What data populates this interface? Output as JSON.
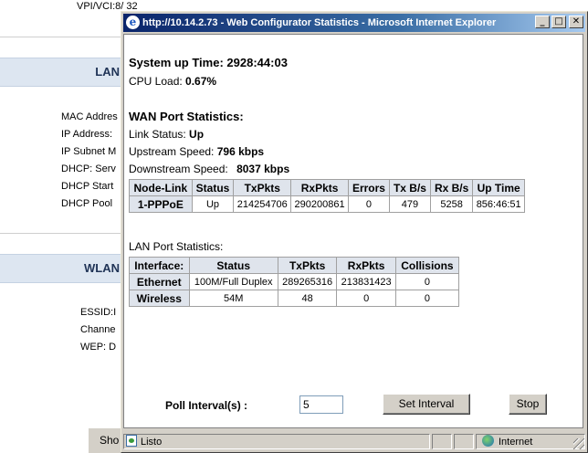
{
  "background": {
    "vpi_label": "VPI/VCI:8/ 32",
    "lan_header": "LAN",
    "lan_fields": [
      "MAC Addres",
      "IP Address:",
      "IP Subnet M",
      "DHCP: Serv",
      "DHCP Start",
      "DHCP Pool"
    ],
    "wlan_header": "WLAN",
    "wlan_fields": [
      "ESSID:I",
      "Channe",
      "WEP: D"
    ],
    "bottom_button": "Sho"
  },
  "window": {
    "title": "http://10.14.2.73 - Web Configurator Statistics - Microsoft Internet Explorer",
    "min_glyph": "_",
    "max_glyph": "□",
    "close_glyph": "✕",
    "icon_glyph": "e"
  },
  "system": {
    "uptime_label": "System up Time:",
    "uptime_value": "2928:44:03",
    "cpu_label": "CPU Load:",
    "cpu_value": "0.67%"
  },
  "wan": {
    "heading": "WAN Port Statistics:",
    "link_status_label": "Link Status:",
    "link_status_value": "Up",
    "upstream_label": "Upstream Speed:",
    "upstream_value": "796 kbps",
    "downstream_label": "Downstream Speed:",
    "downstream_value": "8037 kbps",
    "columns": [
      "Node-Link",
      "Status",
      "TxPkts",
      "RxPkts",
      "Errors",
      "Tx B/s",
      "Rx B/s",
      "Up Time"
    ],
    "row": [
      "1-PPPoE",
      "Up",
      "214254706",
      "290200861",
      "0",
      "479",
      "5258",
      "856:46:51"
    ]
  },
  "lan": {
    "heading": "LAN Port Statistics:",
    "columns": [
      "Interface:",
      "Status",
      "TxPkts",
      "RxPkts",
      "Collisions"
    ],
    "rows": [
      [
        "Ethernet",
        "100M/Full Duplex",
        "289265316",
        "213831423",
        "0"
      ],
      [
        "Wireless",
        "54M",
        "48",
        "0",
        "0"
      ]
    ]
  },
  "poll": {
    "label": "Poll Interval(s) :",
    "value": "5",
    "set_button": "Set Interval",
    "stop_button": "Stop"
  },
  "statusbar": {
    "status_text": "Listo",
    "zone_text": "Internet"
  }
}
